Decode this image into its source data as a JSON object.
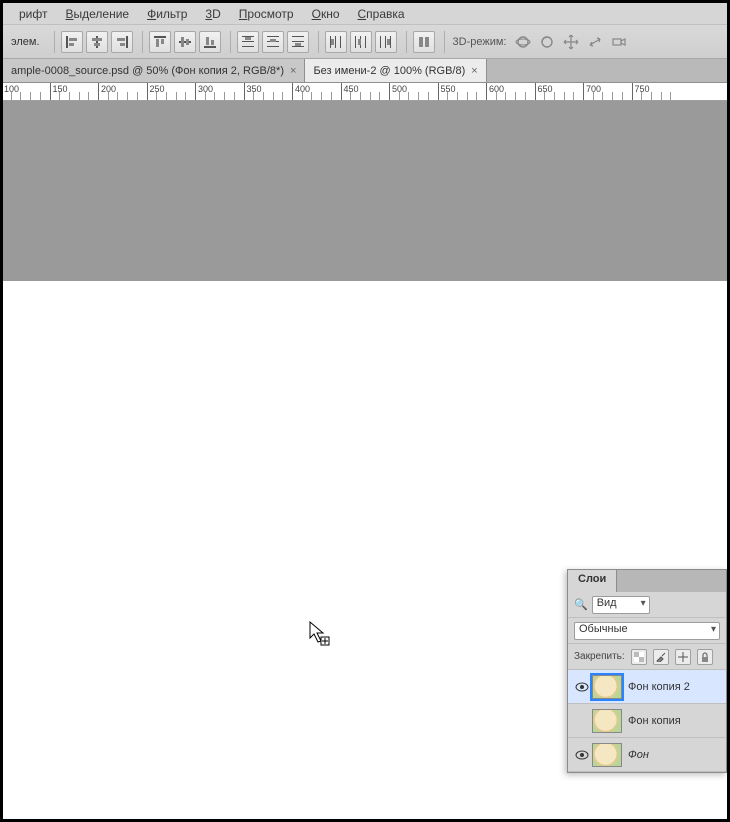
{
  "menu": {
    "items": [
      "рифт",
      "Выделение",
      "Фильтр",
      "3D",
      "Просмотр",
      "Окно",
      "Справка"
    ]
  },
  "optionsbar": {
    "label": "элем.",
    "mode3d_label": "3D-режим:"
  },
  "tabs": [
    {
      "label": "ample-0008_source.psd @ 50% (Фон копия 2, RGB/8*)",
      "active": false
    },
    {
      "label": "Без имени-2 @ 100% (RGB/8)",
      "active": true
    }
  ],
  "ruler": {
    "start": 100,
    "end": 750,
    "step": 50
  },
  "layers_panel": {
    "title": "Слои",
    "kind_selected": "Вид",
    "blend_selected": "Обычные",
    "lock_label": "Закрепить:",
    "layers": [
      {
        "name": "Фон копия 2",
        "visible": true,
        "selected": true,
        "italic": false
      },
      {
        "name": "Фон копия",
        "visible": false,
        "selected": false,
        "italic": false
      },
      {
        "name": "Фон",
        "visible": true,
        "selected": false,
        "italic": true
      }
    ]
  }
}
